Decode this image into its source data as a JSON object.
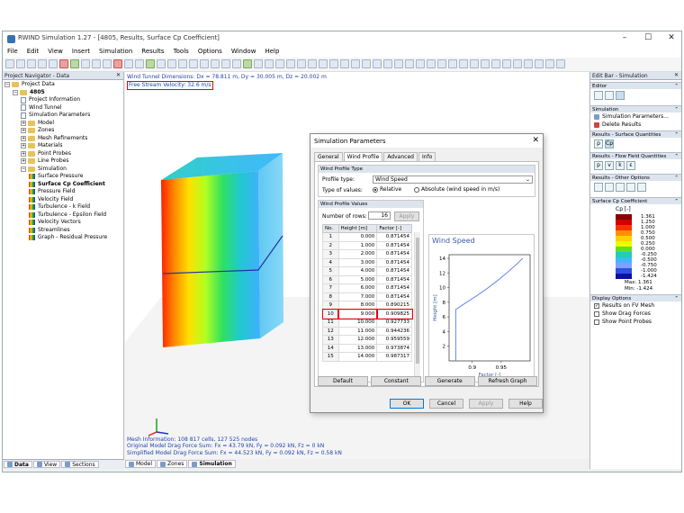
{
  "window": {
    "title": "RWIND Simulation 1.27 - [4805, Results, Surface Cp Coefficient]"
  },
  "menu": [
    "File",
    "Edit",
    "View",
    "Insert",
    "Simulation",
    "Results",
    "Tools",
    "Options",
    "Window",
    "Help"
  ],
  "navigator": {
    "title": "Project Navigator - Data",
    "tree": [
      {
        "label": "Project Data",
        "indent": 0,
        "icon": "folder"
      },
      {
        "label": "4805",
        "indent": 1,
        "icon": "folder",
        "bold": true
      },
      {
        "label": "Project Information",
        "indent": 2,
        "icon": "doc"
      },
      {
        "label": "Wind Tunnel",
        "indent": 2,
        "icon": "doc"
      },
      {
        "label": "Simulation Parameters",
        "indent": 2,
        "icon": "doc"
      },
      {
        "label": "Model",
        "indent": 2,
        "icon": "folder"
      },
      {
        "label": "Zones",
        "indent": 2,
        "icon": "folder"
      },
      {
        "label": "Mesh Refinements",
        "indent": 2,
        "icon": "folder"
      },
      {
        "label": "Materials",
        "indent": 2,
        "icon": "folder"
      },
      {
        "label": "Point Probes",
        "indent": 2,
        "icon": "folder"
      },
      {
        "label": "Line Probes",
        "indent": 2,
        "icon": "folder"
      },
      {
        "label": "Simulation",
        "indent": 2,
        "icon": "folder"
      },
      {
        "label": "Surface Pressure",
        "indent": 3,
        "icon": "res"
      },
      {
        "label": "Surface Cp Coefficient",
        "indent": 3,
        "icon": "res",
        "bold": true
      },
      {
        "label": "Pressure Field",
        "indent": 3,
        "icon": "res"
      },
      {
        "label": "Velocity Field",
        "indent": 3,
        "icon": "res"
      },
      {
        "label": "Turbulence - k Field",
        "indent": 3,
        "icon": "res"
      },
      {
        "label": "Turbulence - Epsilon Field",
        "indent": 3,
        "icon": "res"
      },
      {
        "label": "Velocity Vectors",
        "indent": 3,
        "icon": "res"
      },
      {
        "label": "Streamlines",
        "indent": 3,
        "icon": "res"
      },
      {
        "label": "Graph - Residual Pressure",
        "indent": 3,
        "icon": "res"
      }
    ],
    "tabs": [
      "Data",
      "View",
      "Sections"
    ]
  },
  "view": {
    "tunnel_dims": "Wind Tunnel Dimensions: Dx = 78.811 m, Dy = 30.005 m, Dz = 20.002 m",
    "velocity": "Free Stream Velocity: 32.6 m/s",
    "mesh_info": "Mesh Information: 108 817 cells, 127 525 nodes",
    "orig_drag": "Original Model Drag Force Sum: Fx = 43.79 kN, Fy = 0.092 kN, Fz = 0 kN",
    "simp_drag": "Simplified Model Drag Force Sum: Fx = 44.523 kN, Fy = 0.092 kN, Fz = 0.58 kN",
    "tabs": [
      "Model",
      "Zones",
      "Simulation"
    ]
  },
  "editbar": {
    "title": "Edit Bar - Simulation",
    "sec_editor": "Editor",
    "sec_simulation": "Simulation",
    "sim_params": "Simulation Parameters...",
    "delete_results": "Delete Results",
    "sec_surface": "Results - Surface Quantities",
    "surface_btns": [
      "p",
      "Cp"
    ],
    "sec_flow": "Results - Flow Field Quantities",
    "flow_btns": [
      "p",
      "v",
      "k",
      "ε"
    ],
    "sec_other": "Results - Other Options",
    "sec_cp": "Surface Cp Coefficient",
    "cp_unit": "Cp [-]",
    "legend": [
      {
        "value": "1.361",
        "color": "#8b0000"
      },
      {
        "value": "1.250",
        "color": "#d00000"
      },
      {
        "value": "1.000",
        "color": "#ff3000"
      },
      {
        "value": "0.750",
        "color": "#ff9000"
      },
      {
        "value": "0.500",
        "color": "#ffd000"
      },
      {
        "value": "0.250",
        "color": "#e8ff00"
      },
      {
        "value": "0.000",
        "color": "#60e020"
      },
      {
        "value": "-0.250",
        "color": "#20d0b0"
      },
      {
        "value": "-0.500",
        "color": "#40b8ff"
      },
      {
        "value": "-0.750",
        "color": "#80a0ff"
      },
      {
        "value": "-1.000",
        "color": "#3050e0"
      },
      {
        "value": "-1.424",
        "color": "#1010a0"
      }
    ],
    "max_label": "Max:",
    "max_val": "1.361",
    "min_label": "Min:",
    "min_val": "-1.424",
    "sec_display": "Display Options",
    "display": [
      {
        "label": "Results on FV Mesh",
        "checked": true
      },
      {
        "label": "Show Drag Forces",
        "checked": false
      },
      {
        "label": "Show Point Probes",
        "checked": false
      }
    ]
  },
  "dialog": {
    "title": "Simulation Parameters",
    "tabs": [
      "General",
      "Wind Profile",
      "Advanced",
      "Info"
    ],
    "grp_type": "Wind Profile Type",
    "profile_type_label": "Profile type:",
    "profile_type_value": "Wind Speed",
    "type_values_label": "Type of values:",
    "relative": "Relative",
    "absolute": "Absolute (wind speed in m/s)",
    "grp_values": "Wind Profile Values",
    "rows_label": "Number of rows:",
    "rows_value": "16",
    "apply_small": "Apply",
    "col_no": "No.",
    "col_height": "Height [m]",
    "col_factor": "Factor [-]",
    "rows": [
      [
        "1",
        "0.000",
        "0.871454"
      ],
      [
        "2",
        "1.000",
        "0.871454"
      ],
      [
        "3",
        "2.000",
        "0.871454"
      ],
      [
        "4",
        "3.000",
        "0.871454"
      ],
      [
        "5",
        "4.000",
        "0.871454"
      ],
      [
        "6",
        "5.000",
        "0.871454"
      ],
      [
        "7",
        "6.000",
        "0.871454"
      ],
      [
        "8",
        "7.000",
        "0.871454"
      ],
      [
        "9",
        "8.000",
        "0.890215"
      ],
      [
        "10",
        "9.000",
        "0.909825"
      ],
      [
        "11",
        "10.000",
        "0.927733"
      ],
      [
        "12",
        "11.000",
        "0.944236"
      ],
      [
        "13",
        "12.000",
        "0.959559"
      ],
      [
        "14",
        "13.000",
        "0.973874"
      ],
      [
        "15",
        "14.000",
        "0.987317"
      ]
    ],
    "buttons_row": [
      "Default",
      "Constant",
      "Generate",
      "Refresh Graph"
    ],
    "ok": "OK",
    "cancel": "Cancel",
    "apply": "Apply",
    "help": "Help"
  },
  "chart_data": {
    "type": "line",
    "title": "Wind Speed",
    "xlabel": "Factor [-]",
    "ylabel": "Height [m]",
    "xlim": [
      0.86,
      1.0
    ],
    "ylim": [
      0,
      14.5
    ],
    "xticks": [
      "0.9",
      "0.95"
    ],
    "yticks": [
      "2",
      "4",
      "6",
      "8",
      "10",
      "12",
      "14"
    ],
    "x": [
      0.871454,
      0.871454,
      0.871454,
      0.871454,
      0.871454,
      0.871454,
      0.871454,
      0.871454,
      0.890215,
      0.909825,
      0.927733,
      0.944236,
      0.959559,
      0.973874,
      0.987317
    ],
    "y": [
      0,
      1,
      2,
      3,
      4,
      5,
      6,
      7,
      8,
      9,
      10,
      11,
      12,
      13,
      14
    ],
    "color": "#5577ee"
  }
}
